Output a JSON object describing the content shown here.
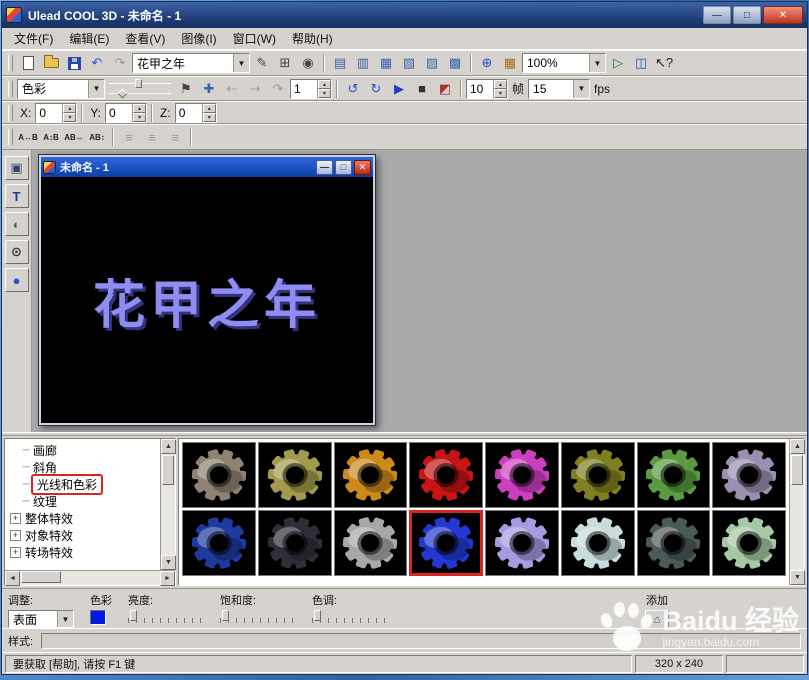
{
  "colors": {
    "selection_highlight": "#dd2222",
    "canvas_text": "#8d8df2",
    "canvas_text_shadow": "#34347e",
    "swatch": "#0018e8"
  },
  "window": {
    "title": "Ulead COOL 3D - 未命名 - 1",
    "minimize_glyph": "—",
    "maximize_glyph": "□",
    "close_glyph": "✕"
  },
  "menu": {
    "items": [
      {
        "name": "menu-file",
        "label": "文件(F)"
      },
      {
        "name": "menu-edit",
        "label": "编辑(E)"
      },
      {
        "name": "menu-view",
        "label": "查看(V)"
      },
      {
        "name": "menu-image",
        "label": "图像(I)"
      },
      {
        "name": "menu-window",
        "label": "窗口(W)"
      },
      {
        "name": "menu-help",
        "label": "帮助(H)"
      }
    ]
  },
  "toolbar1": {
    "file_icons": [
      {
        "name": "new-document-icon",
        "cls": "ic-page"
      },
      {
        "name": "open-folder-icon",
        "cls": "ic-folder"
      },
      {
        "name": "save-icon",
        "cls": "ic-floppy"
      }
    ],
    "history_icons": [
      {
        "name": "undo-icon",
        "glyph": "↶",
        "color": "#2a52cc"
      },
      {
        "name": "redo-icon",
        "glyph": "↷",
        "disabled": true
      }
    ],
    "font_value": "花甲之年",
    "mid_icons": [
      {
        "name": "edit-text-icon",
        "glyph": "✎",
        "color": "#444444"
      },
      {
        "name": "grid-snap-icon",
        "glyph": "⊞",
        "color": "#444444"
      },
      {
        "name": "camera-view-icon",
        "glyph": "◉",
        "color": "#444444"
      }
    ],
    "window_icons": [
      {
        "name": "toolbar-toggle-icon",
        "glyph": "▤",
        "color": "#3a62b0"
      },
      {
        "name": "toolbar-toggle-icon",
        "glyph": "▥",
        "color": "#3a62b0"
      },
      {
        "name": "toolbar-toggle-icon",
        "glyph": "▦",
        "color": "#3a62b0"
      },
      {
        "name": "toolbar-toggle-icon",
        "glyph": "▧",
        "color": "#3a62b0"
      },
      {
        "name": "toolbar-toggle-icon",
        "glyph": "▨",
        "color": "#3a62b0"
      },
      {
        "name": "toolbar-toggle-icon",
        "glyph": "▩",
        "color": "#3a62b0"
      }
    ],
    "globe_icons": [
      {
        "name": "globe-icon",
        "glyph": "⊕",
        "color": "#2a52cc"
      },
      {
        "name": "texture-grid-icon",
        "glyph": "▦",
        "color": "#b06a20"
      }
    ],
    "zoom_value": "100%",
    "right_icons": [
      {
        "name": "render-animation-icon",
        "glyph": "▷",
        "color": "#1f6f2f"
      },
      {
        "name": "export-icon",
        "glyph": "◫",
        "color": "#2a52cc"
      },
      {
        "name": "context-help-icon",
        "glyph": "↖?",
        "color": "#222222"
      }
    ]
  },
  "toolbar2": {
    "combo_value": "色彩",
    "flag_icons": [
      {
        "name": "flag-icon",
        "glyph": "⚑",
        "color": "#444444"
      }
    ],
    "transform_icons": [
      {
        "name": "nudge-tool-icon",
        "glyph": "✚",
        "color": "#3a62b0"
      },
      {
        "name": "step-back-icon",
        "glyph": "⇠",
        "disabled": true
      },
      {
        "name": "step-forward-icon",
        "glyph": "⇢",
        "disabled": true
      },
      {
        "name": "arc-rotate-icon",
        "glyph": "↷",
        "disabled": true
      }
    ],
    "spin1": "1",
    "rotate_icons": [
      {
        "name": "rotate-ccw-icon",
        "glyph": "↺",
        "color": "#2a52cc"
      },
      {
        "name": "rotate-cw-icon",
        "glyph": "↻",
        "color": "#2a52cc"
      }
    ],
    "transport_icons": [
      {
        "name": "play-button",
        "glyph": "▶",
        "color": "#1a44cc"
      },
      {
        "name": "stop-button",
        "glyph": "■",
        "color": "#333333"
      },
      {
        "name": "preview-toggle-icon",
        "glyph": "◩",
        "color": "#b03030"
      }
    ],
    "spin2": "10",
    "frame_label": "帧",
    "frames_value": "15",
    "fps_label": "fps"
  },
  "coords": {
    "x_label": "X:",
    "x": "0",
    "y_label": "Y:",
    "y": "0",
    "z_label": "Z:",
    "z": "0"
  },
  "texttb": {
    "text_icons": [
      {
        "name": "char-spacing-icon",
        "glyph": "A↔B",
        "color": "#222222"
      },
      {
        "name": "line-spacing-icon",
        "glyph": "A↕B",
        "color": "#222222"
      },
      {
        "name": "kerning-icon",
        "glyph": "AB↔",
        "color": "#222222"
      },
      {
        "name": "baseline-icon",
        "glyph": "AB↕",
        "color": "#222222"
      }
    ],
    "align_icons": [
      {
        "name": "align-left-icon",
        "glyph": "≡",
        "disabled": true
      },
      {
        "name": "align-center-icon",
        "glyph": "≡",
        "disabled": true
      },
      {
        "name": "align-right-icon",
        "glyph": "≡",
        "disabled": true
      }
    ]
  },
  "left_toolbar": {
    "icons": [
      {
        "name": "text-dialog-button",
        "glyph": "▣",
        "color": "#334466"
      },
      {
        "name": "insert-text-button",
        "glyph": "T",
        "color": "#223a8c"
      },
      {
        "name": "insert-graphics-button",
        "glyph": "◐",
        "color": "#3a7a3a"
      },
      {
        "name": "zoom-tool-button",
        "glyph": "⊙",
        "color": "#333333"
      },
      {
        "name": "sphere-tool-button",
        "glyph": "●",
        "color": "#2a52cc"
      }
    ]
  },
  "document": {
    "title": "未命名 - 1",
    "minimize_glyph": "—",
    "maximize_glyph": "□",
    "close_glyph": "✕",
    "text": "花甲之年"
  },
  "tree": {
    "items": [
      {
        "label": "画廊"
      },
      {
        "label": "斜角"
      },
      {
        "label": "光线和色彩",
        "highlighted": true
      },
      {
        "label": "纹理"
      },
      {
        "label": "整体特效",
        "expander": true
      },
      {
        "label": "对象特效",
        "expander": true
      },
      {
        "label": "转场特效",
        "expander": true
      }
    ]
  },
  "gallery": {
    "items": [
      {
        "color": "#8e8272"
      },
      {
        "color": "#a39a4e"
      },
      {
        "color": "#cc8a1a"
      },
      {
        "color": "#c81414"
      },
      {
        "color": "#cc3fc0"
      },
      {
        "color": "#7f7f1f"
      },
      {
        "color": "#5a9a40"
      },
      {
        "color": "#9a8fae"
      },
      {
        "color": "#1e3a9e"
      },
      {
        "color": "#2e2e38"
      },
      {
        "color": "#a8a8a8"
      },
      {
        "color": "#2238d0",
        "selected": true
      },
      {
        "color": "#a79ae0"
      },
      {
        "color": "#c8dcdc"
      },
      {
        "color": "#4a5a58"
      },
      {
        "color": "#a5c8a5"
      }
    ]
  },
  "adjust": {
    "section_label": "调整:",
    "surface_value": "表面",
    "color_label": "色彩",
    "brightness_label": "亮度:",
    "saturation_label": "饱和度:",
    "hue_label": "色调:",
    "add_label": "添加",
    "add_glyph": "⌂"
  },
  "style_section": {
    "label": "样式:"
  },
  "statusbar": {
    "help_text": "要获取 [帮助], 请按 F1 键",
    "dimensions": "320 x 240"
  },
  "watermark": {
    "brand": "Baidu",
    "product": "经验",
    "url": "jingyan.baidu.com"
  }
}
